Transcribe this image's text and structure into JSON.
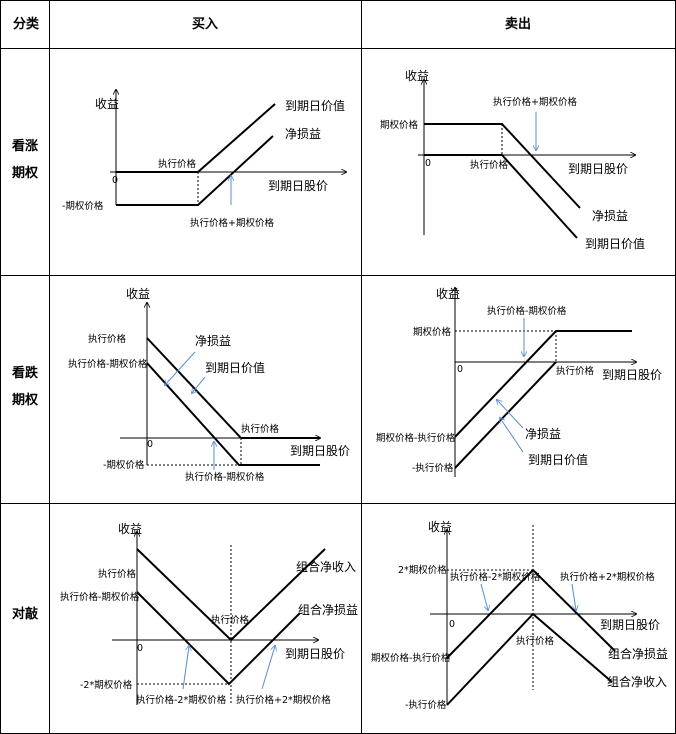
{
  "table": {
    "header": {
      "category": "分类",
      "buy": "买入",
      "sell": "卖出"
    },
    "rows": [
      "看涨\n期权",
      "看跌\n期权",
      "对敲"
    ]
  },
  "call_buy": {
    "y_axis": "收益",
    "origin": "0",
    "strike_label": "执行价格",
    "neg_premium_label": "-期权价格",
    "breakeven_label": "执行价格+期权价格",
    "expiry_value_label": "到期日价值",
    "net_pl_label": "净损益",
    "x_axis": "到期日股价"
  },
  "call_sell": {
    "y_axis": "收益",
    "origin": "0",
    "premium_label": "期权价格",
    "strike_label": "执行价格",
    "breakeven_label": "执行价格+期权价格",
    "x_axis": "到期日股价",
    "net_pl_label": "净损益",
    "expiry_value_label": "到期日价值"
  },
  "put_buy": {
    "y_axis": "收益",
    "origin": "0",
    "strike_label": "执行价格",
    "strike_minus_premium_label": "执行价格-期权价格",
    "net_pl_label": "净损益",
    "expiry_value_label": "到期日价值",
    "strike_x_label": "执行价格",
    "x_axis": "到期日股价",
    "neg_premium_label": "-期权价格",
    "breakeven_label": "执行价格-期权价格"
  },
  "put_sell": {
    "y_axis": "收益",
    "origin": "0",
    "breakeven_label": "执行价格-期权价格",
    "premium_label": "期权价格",
    "strike_label": "执行价格",
    "x_axis": "到期日股价",
    "premium_minus_strike_label": "期权价格-执行价格",
    "neg_strike_label": "-执行价格",
    "net_pl_label": "净损益",
    "expiry_value_label": "到期日价值"
  },
  "straddle_buy": {
    "y_axis": "收益",
    "origin": "0",
    "strike_label": "执行价格",
    "strike_minus_premium_label": "执行价格-期权价格",
    "combo_income_label": "组合净收入",
    "combo_pl_label": "组合净损益",
    "strike_x_label": "执行价格",
    "x_axis": "到期日股价",
    "neg_2premium_label": "-2*期权价格",
    "low_breakeven_label": "执行价格-2*期权价格",
    "high_breakeven_label": "执行价格+2*期权价格"
  },
  "straddle_sell": {
    "y_axis": "收益",
    "origin": "0",
    "two_premium_label": "2*期权价格",
    "low_breakeven_label": "执行价格-2*期权价格",
    "high_breakeven_label": "执行价格+2*期权价格",
    "x_axis": "到期日股价",
    "strike_x_label": "执行价格",
    "premium_minus_strike_label": "期权价格-执行价格",
    "neg_strike_label": "-执行价格",
    "combo_pl_label": "组合净损益",
    "combo_income_label": "组合净收入"
  }
}
